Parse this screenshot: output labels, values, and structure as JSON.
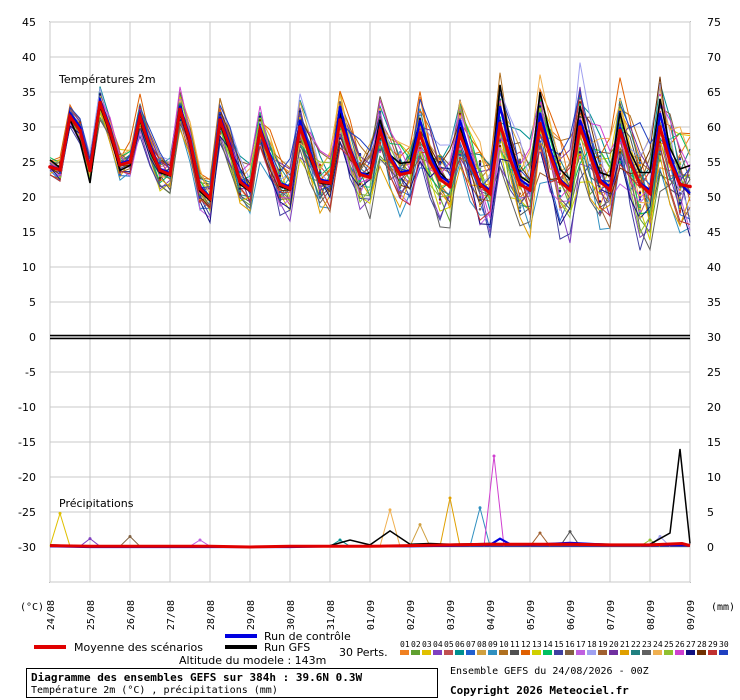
{
  "chart_data": {
    "type": "line",
    "section_labels": {
      "temperature": "Températures 2m",
      "precipitation": "Précipitations"
    },
    "left_axis_ticks": [
      "45",
      "40",
      "35",
      "30",
      "25",
      "20",
      "15",
      "10",
      "5",
      "0",
      "-5",
      "-10",
      "-15",
      "-20",
      "-25",
      "-30"
    ],
    "right_axis_ticks": [
      "75",
      "70",
      "65",
      "60",
      "55",
      "50",
      "45",
      "40",
      "35",
      "30",
      "25",
      "20",
      "15",
      "10",
      "5",
      "0"
    ],
    "x_labels": [
      "24/08",
      "25/08",
      "26/08",
      "27/08",
      "28/08",
      "29/08",
      "30/08",
      "31/08",
      "01/09",
      "02/09",
      "03/09",
      "04/09",
      "05/09",
      "06/09",
      "07/09",
      "08/09",
      "09/09"
    ],
    "left_unit": "(°C)",
    "right_unit": "(mm)",
    "temperature_series": {
      "mean": {
        "name": "Moyenne des scénarios",
        "color": "#e00000",
        "x": [
          0,
          0.25,
          0.5,
          0.75,
          1,
          1.25,
          1.5,
          1.75,
          2,
          2.25,
          2.5,
          2.75,
          3,
          3.25,
          3.5,
          3.75,
          4,
          4.25,
          4.5,
          4.75,
          5,
          5.25,
          5.5,
          5.75,
          6,
          6.25,
          6.5,
          6.75,
          7,
          7.25,
          7.5,
          7.75,
          8,
          8.25,
          8.5,
          8.75,
          9,
          9.25,
          9.5,
          9.75,
          10,
          10.25,
          10.5,
          10.75,
          11,
          11.25,
          11.5,
          11.75,
          12,
          12.25,
          12.5,
          12.75,
          13,
          13.25,
          13.5,
          13.75,
          14,
          14.25,
          14.5,
          14.75,
          15,
          15.25,
          15.5,
          15.75,
          16
        ],
        "y": [
          24.3,
          23.9,
          31.5,
          29.5,
          23.8,
          33.5,
          29.5,
          24.6,
          25,
          31.5,
          27,
          23.8,
          23.2,
          32.5,
          28,
          21.2,
          19.8,
          31,
          27,
          22.2,
          21,
          29.5,
          25.5,
          21.8,
          21.2,
          30,
          26,
          22.2,
          22,
          31,
          26.5,
          23.2,
          22.8,
          29.5,
          25.5,
          23.2,
          23.5,
          29,
          25,
          22.5,
          21.5,
          29,
          25,
          21.8,
          20.5,
          30.5,
          25.5,
          21.8,
          21,
          30.5,
          26,
          22.2,
          21,
          30,
          26,
          22.2,
          21,
          29.5,
          25,
          21.8,
          20.5,
          30,
          25,
          21.8,
          21.5
        ]
      },
      "control": {
        "name": "Run de contrôle",
        "color": "#0000e0",
        "x": [
          0,
          0.25,
          0.5,
          0.75,
          1,
          1.25,
          1.5,
          1.75,
          2,
          2.25,
          2.5,
          2.75,
          3,
          3.25,
          3.5,
          3.75,
          4,
          4.25,
          4.5,
          4.75,
          5,
          5.25,
          5.5,
          5.75,
          6,
          6.25,
          6.5,
          6.75,
          7,
          7.25,
          7.5,
          7.75,
          8,
          8.25,
          8.5,
          8.75,
          9,
          9.25,
          9.5,
          9.75,
          10,
          10.25,
          10.5,
          10.75,
          11,
          11.25,
          11.5,
          11.75,
          12,
          12.25,
          12.5,
          12.75,
          13,
          13.25,
          13.5,
          13.75,
          14,
          14.25,
          14.5,
          14.75,
          15,
          15.25,
          15.5,
          15.75,
          16
        ],
        "y": [
          24.4,
          24,
          32,
          30,
          24.2,
          33.8,
          30,
          24.8,
          25.2,
          32,
          27.5,
          24,
          23.4,
          33,
          28.5,
          21.5,
          20,
          31.5,
          27.5,
          22.5,
          21.3,
          30,
          26,
          22,
          21.5,
          31,
          26.5,
          22.5,
          22.2,
          33,
          27,
          23.5,
          23,
          30,
          26,
          23.5,
          23.8,
          31,
          26,
          23,
          22,
          31,
          26,
          22,
          21,
          33,
          27,
          22.5,
          21.5,
          32,
          27,
          22.5,
          21.2,
          31,
          27,
          22.5,
          21.5,
          30,
          25.5,
          22,
          21,
          32,
          26,
          22,
          20.5
        ]
      },
      "gfs": {
        "name": "Run GFS",
        "color": "#000000",
        "x": [
          0,
          0.25,
          0.5,
          0.75,
          1,
          1.25,
          1.5,
          1.75,
          2,
          2.25,
          2.5,
          2.75,
          3,
          3.25,
          3.5,
          3.75,
          4,
          4.25,
          4.5,
          4.75,
          5,
          5.25,
          5.5,
          5.75,
          6,
          6.25,
          6.5,
          6.75,
          7,
          7.25,
          7.5,
          7.75,
          8,
          8.25,
          8.5,
          8.75,
          9,
          9.25,
          9.5,
          9.75,
          10,
          10.25,
          10.5,
          10.75,
          11,
          11.25,
          11.5,
          11.75,
          12,
          12.25,
          12.5,
          12.75,
          13,
          13.25,
          13.5,
          13.75,
          14,
          14.25,
          14.5,
          14.75,
          15,
          15.25,
          15.5,
          15.75,
          16
        ],
        "y": [
          25.3,
          24.2,
          31,
          28,
          22,
          33,
          29,
          23.8,
          24.5,
          31,
          26.5,
          23.5,
          23,
          32,
          27.5,
          20.8,
          19.5,
          30.5,
          26.5,
          21.8,
          20.8,
          29.5,
          25.5,
          21.5,
          21,
          30,
          25.5,
          22,
          21.8,
          32,
          26.5,
          23,
          23.5,
          31,
          26,
          24.8,
          25,
          31,
          26.5,
          23.5,
          22,
          30,
          25.5,
          21.5,
          21,
          36,
          28,
          23,
          22,
          35,
          29,
          24,
          22.5,
          33,
          27.5,
          23.5,
          23,
          32,
          26.5,
          23.5,
          23.5,
          34,
          27,
          24,
          24.5
        ]
      },
      "members": [
        {
          "name": "01",
          "color": "#f08020",
          "a": 0.0,
          "b": 0.2
        },
        {
          "name": "02",
          "color": "#60a030",
          "a": 0.6,
          "b": -0.3
        },
        {
          "name": "03",
          "color": "#e0c000",
          "a": 1.2,
          "b": 0.4
        },
        {
          "name": "04",
          "color": "#8040c0",
          "a": 1.8,
          "b": -0.5
        },
        {
          "name": "05",
          "color": "#c05050",
          "a": 2.4,
          "b": 0.1
        },
        {
          "name": "06",
          "color": "#009090",
          "a": 3.0,
          "b": 0.6
        },
        {
          "name": "07",
          "color": "#2060d0",
          "a": 3.6,
          "b": -0.2
        },
        {
          "name": "08",
          "color": "#d0a040",
          "a": 4.2,
          "b": 0.3
        },
        {
          "name": "09",
          "color": "#3090c0",
          "a": 4.8,
          "b": -0.6
        },
        {
          "name": "10",
          "color": "#b07020",
          "a": 5.4,
          "b": 0.5
        },
        {
          "name": "11",
          "color": "#505050",
          "a": 6.0,
          "b": -0.1
        },
        {
          "name": "12",
          "color": "#e06000",
          "a": 0.3,
          "b": 0.7
        },
        {
          "name": "13",
          "color": "#d0d000",
          "a": 0.9,
          "b": -0.4
        },
        {
          "name": "14",
          "color": "#00c060",
          "a": 1.5,
          "b": 0.2
        },
        {
          "name": "15",
          "color": "#4040a0",
          "a": 2.1,
          "b": -0.7
        },
        {
          "name": "16",
          "color": "#806040",
          "a": 2.7,
          "b": 0.4
        },
        {
          "name": "17",
          "color": "#c060e0",
          "a": 3.3,
          "b": -0.3
        },
        {
          "name": "18",
          "color": "#a0a0f0",
          "a": 3.9,
          "b": 0.6
        },
        {
          "name": "19",
          "color": "#a06030",
          "a": 4.5,
          "b": -0.2
        },
        {
          "name": "20",
          "color": "#7030a0",
          "a": 5.1,
          "b": 0.3
        },
        {
          "name": "21",
          "color": "#e0a000",
          "a": 5.7,
          "b": -0.5
        },
        {
          "name": "22",
          "color": "#208080",
          "a": 0.15,
          "b": 0.1
        },
        {
          "name": "23",
          "color": "#606060",
          "a": 0.75,
          "b": -0.6
        },
        {
          "name": "24",
          "color": "#f0b050",
          "a": 1.35,
          "b": 0.5
        },
        {
          "name": "25",
          "color": "#90c030",
          "a": 1.95,
          "b": -0.1
        },
        {
          "name": "26",
          "color": "#d040d0",
          "a": 2.55,
          "b": 0.4
        },
        {
          "name": "27",
          "color": "#101080",
          "a": 3.15,
          "b": -0.4
        },
        {
          "name": "28",
          "color": "#703000",
          "a": 3.75,
          "b": 0.2
        },
        {
          "name": "29",
          "color": "#c03030",
          "a": 4.35,
          "b": -0.3
        },
        {
          "name": "30",
          "color": "#2040c0",
          "a": 4.95,
          "b": 0.6
        }
      ]
    },
    "precipitation_series": {
      "mean": {
        "name": "Moyenne des scénarios",
        "color": "#e00000",
        "x": [
          0,
          1,
          2,
          3,
          4,
          5,
          6,
          7,
          8,
          9,
          10,
          11,
          12,
          13,
          14,
          15,
          15.8,
          16
        ],
        "y": [
          0.2,
          0.1,
          0.1,
          0.1,
          0.1,
          0.0,
          0.1,
          0.1,
          0.1,
          0.2,
          0.3,
          0.4,
          0.4,
          0.4,
          0.3,
          0.3,
          0.5,
          0.2
        ]
      },
      "control": {
        "name": "Run de contrôle",
        "color": "#0000e0",
        "x": [
          0,
          1,
          2,
          3,
          4,
          5,
          6,
          7,
          8,
          9,
          10,
          10.5,
          11,
          11.25,
          11.5,
          12,
          13,
          14,
          15,
          16
        ],
        "y": [
          0.1,
          0,
          0,
          0,
          0,
          0,
          0,
          0.1,
          0.1,
          0.1,
          0.2,
          0.3,
          0.3,
          1.2,
          0.4,
          0.3,
          0.6,
          0.3,
          0.3,
          0.3
        ]
      },
      "gfs": {
        "name": "Run GFS",
        "color": "#000000",
        "x": [
          0,
          1,
          2,
          3,
          4,
          5,
          6,
          7,
          7.5,
          8,
          8.5,
          9,
          9.5,
          10,
          11,
          12,
          13,
          14,
          15,
          15.5,
          15.75,
          16
        ],
        "y": [
          0.3,
          0.1,
          0,
          0.1,
          0,
          0,
          0.1,
          0.2,
          1,
          0.3,
          2.3,
          0.4,
          0.5,
          0.4,
          0.5,
          0.4,
          0.5,
          0.4,
          0.4,
          2,
          14,
          0.5
        ]
      },
      "spikes": [
        {
          "member": "03",
          "x": 0.25,
          "y": 4.8
        },
        {
          "member": "04",
          "x": 1.0,
          "y": 1.2
        },
        {
          "member": "16",
          "x": 2.0,
          "y": 1.5
        },
        {
          "member": "17",
          "x": 3.75,
          "y": 1.0
        },
        {
          "member": "06",
          "x": 7.25,
          "y": 1.0
        },
        {
          "member": "24",
          "x": 8.5,
          "y": 5.3
        },
        {
          "member": "08",
          "x": 9.25,
          "y": 3.2
        },
        {
          "member": "21",
          "x": 10.0,
          "y": 7.0
        },
        {
          "member": "09",
          "x": 10.75,
          "y": 5.6
        },
        {
          "member": "26",
          "x": 11.1,
          "y": 13.0
        },
        {
          "member": "19",
          "x": 12.25,
          "y": 2.0
        },
        {
          "member": "11",
          "x": 13.0,
          "y": 2.2
        },
        {
          "member": "25",
          "x": 15.0,
          "y": 1.0
        },
        {
          "member": "18",
          "x": 15.25,
          "y": 1.5
        }
      ]
    }
  },
  "legend": {
    "mean_label": "Moyenne des scénarios",
    "control_label": "Run de contrôle",
    "gfs_label": "Run GFS",
    "altitude": "Altitude du modele : 143m",
    "perts_label": "30 Perts.",
    "member_numbers": [
      "01",
      "02",
      "03",
      "04",
      "05",
      "06",
      "07",
      "08",
      "09",
      "10",
      "11",
      "12",
      "13",
      "14",
      "15",
      "16",
      "17",
      "18",
      "19",
      "20",
      "21",
      "22",
      "23",
      "24",
      "25",
      "26",
      "27",
      "28",
      "29",
      "30"
    ]
  },
  "info": {
    "title": "Diagramme des ensembles GEFS sur 384h : 39.6N 0.3W",
    "subtitle": "Température 2m (°C) , précipitations (mm)",
    "run": "Ensemble GEFS du 24/08/2026 - 00Z",
    "copyright": "Copyright 2026 Meteociel.fr"
  }
}
